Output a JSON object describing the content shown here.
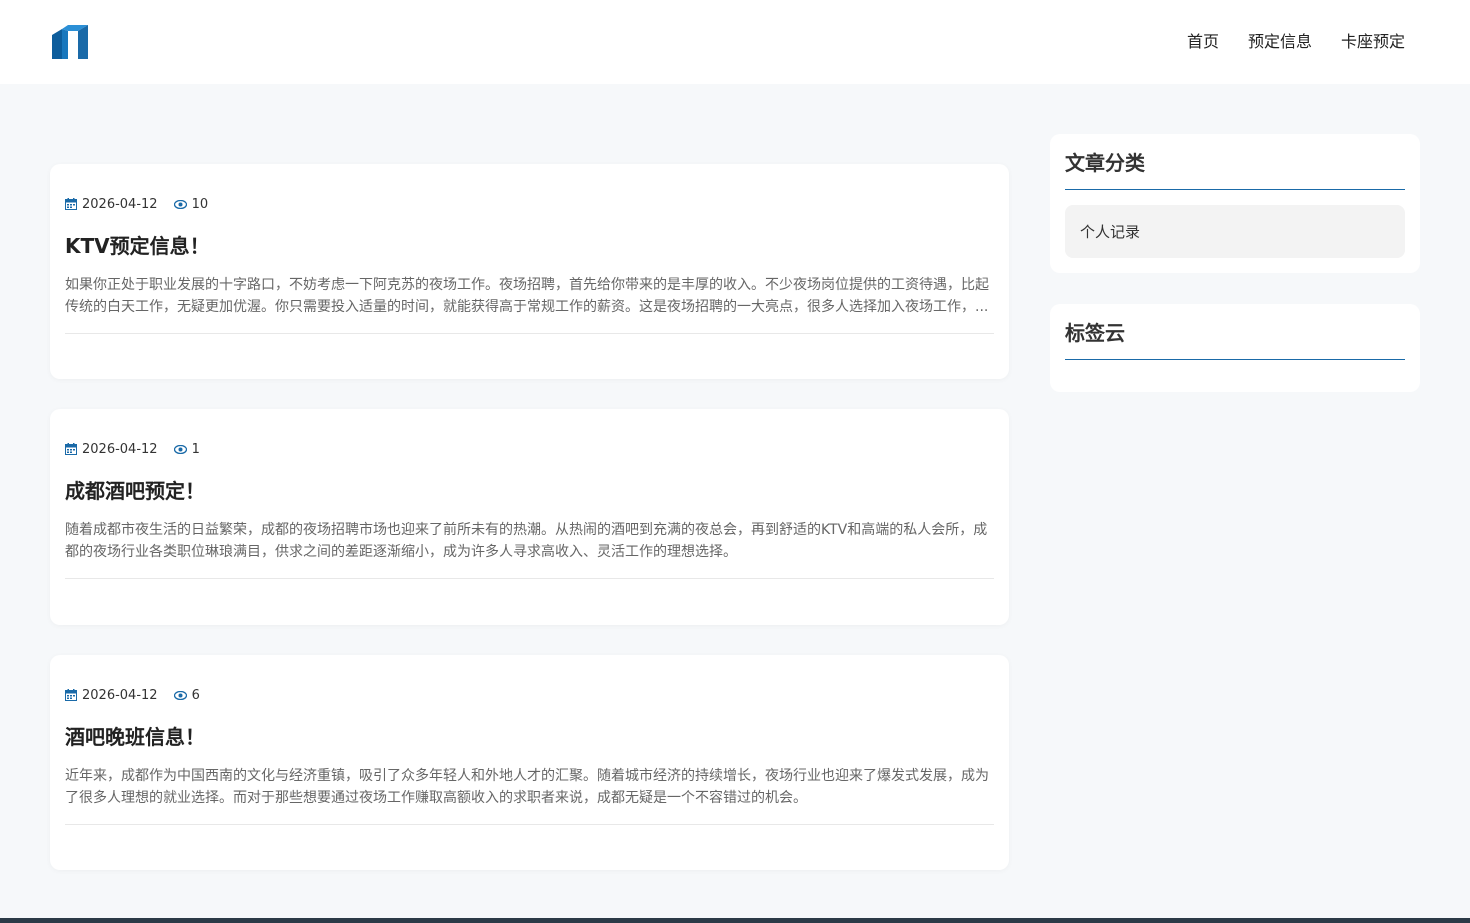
{
  "nav": {
    "home": "首页",
    "booking_info": "预定信息",
    "booth_booking": "卡座预定"
  },
  "colors": {
    "accent": "#1a6aa8",
    "logo_dark": "#0d5d9c",
    "logo_light": "#2b8fd6"
  },
  "icons": {
    "date": "calendar-icon",
    "views": "eye-icon"
  },
  "posts": [
    {
      "date": "2026-04-12",
      "views": "10",
      "title": "KTV预定信息！",
      "excerpt": "如果你正处于职业发展的十字路口，不妨考虑一下阿克苏的夜场工作。夜场招聘，首先给你带来的是丰厚的收入。不少夜场岗位提供的工资待遇，比起传统的白天工作，无疑更加优渥。你只需要投入适量的时间，就能获得高于常规工作的薪资。这是夜场招聘的一大亮点，很多人选择加入夜场工作，..."
    },
    {
      "date": "2026-04-12",
      "views": "1",
      "title": "成都酒吧预定！",
      "excerpt": "随着成都市夜生活的日益繁荣，成都的夜场招聘市场也迎来了前所未有的热潮。从热闹的酒吧到充满的夜总会，再到舒适的KTV和高端的私人会所，成都的夜场行业各类职位琳琅满目，供求之间的差距逐渐缩小，成为许多人寻求高收入、灵活工作的理想选择。"
    },
    {
      "date": "2026-04-12",
      "views": "6",
      "title": "酒吧晚班信息！",
      "excerpt": "近年来，成都作为中国西南的文化与经济重镇，吸引了众多年轻人和外地人才的汇聚。随着城市经济的持续增长，夜场行业也迎来了爆发式发展，成为了很多人理想的就业选择。而对于那些想要通过夜场工作赚取高额收入的求职者来说，成都无疑是一个不容错过的机会。"
    }
  ],
  "sidebar": {
    "categories_title": "文章分类",
    "categories": [
      "个人记录"
    ],
    "tags_title": "标签云"
  }
}
